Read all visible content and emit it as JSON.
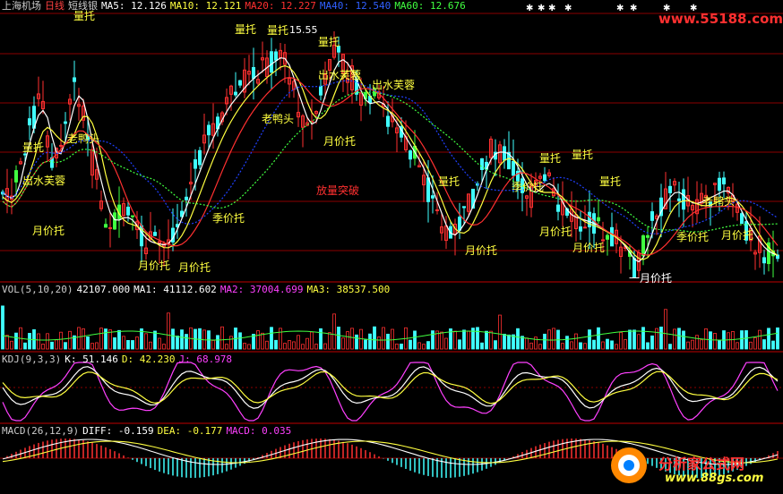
{
  "header": {
    "stock": "上海机场",
    "period": "日线",
    "indicator_name": "短线银",
    "ma5": "MA5: 12.126",
    "ma10": "MA10: 12.121",
    "ma20": "MA20: 12.227",
    "ma40": "MA40: 12.540",
    "ma60": "MA60: 12.676",
    "high_price": "15.55"
  },
  "vol": {
    "name": "VOL(5,10,20)",
    "value": "42107.000",
    "ma1": "MA1: 41112.602",
    "ma2": "MA2: 37004.699",
    "ma3": "MA3: 38537.500"
  },
  "kdj": {
    "name": "KDJ(9,3,3)",
    "k": "K: 51.146",
    "d": "D: 42.230",
    "j": "J: 68.978"
  },
  "macd": {
    "name": "MACD(26,12,9)",
    "diff": "DIFF: -0.159",
    "dea": "DEA: -0.177",
    "macd": "MACD: 0.035"
  },
  "labels": {
    "liangtuo": "量托",
    "yuejiatuo": "月价托",
    "jijiatuo": "季价托",
    "laoyatou": "老鸭头",
    "chushui": "出水芙蓉",
    "fangliang": "放量突破",
    "yuejiatuo2": "一月价托",
    "jijiatuo2": "季价托"
  },
  "watermark": {
    "top_url": "www.55188.com",
    "brand": "分析家公式网",
    "bottom_url": "www.88gs.com"
  },
  "colors": {
    "ma5": "#ffffff",
    "ma10": "#ffff40",
    "ma20": "#ff3030",
    "ma40": "#2040ff",
    "ma60": "#40ff40",
    "up": "#ff3030",
    "down": "#40ffff",
    "grid": "#8b0000",
    "label_yellow": "#ffff40"
  }
}
